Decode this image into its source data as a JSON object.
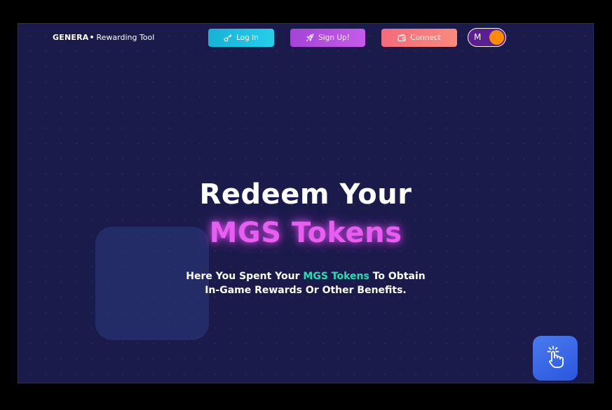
{
  "header": {
    "brand_name": "GENERA",
    "brand_separator": "•",
    "brand_tagline": "Rewarding Tool",
    "login_label": "Log In",
    "login_icon": "key-icon",
    "signup_label": "Sign Up!",
    "signup_icon": "rocket-icon",
    "connect_label": "Connect",
    "connect_icon": "wallet-icon",
    "toggle_letter": "M"
  },
  "hero": {
    "title_line1": "Redeem Your",
    "title_line2": "MGS Tokens",
    "subtitle_prefix": "Here You Spent Your ",
    "subtitle_highlight": "MGS Tokens",
    "subtitle_suffix": " To Obtain",
    "subtitle_line2": "In-Game Rewards Or Other Benefits."
  },
  "fab": {
    "icon": "tap-hand-icon"
  },
  "colors": {
    "background": "#1a1b4b",
    "accent_pink": "#e65ff0",
    "accent_teal": "#22dfb4",
    "login_button": "#15b3d6",
    "signup_button": "#b44fe0",
    "connect_button": "#f57a7c",
    "toggle_bg": "#5b1f91",
    "toggle_knob": "#ff8c00",
    "fab_bg": "#3a68e8"
  }
}
